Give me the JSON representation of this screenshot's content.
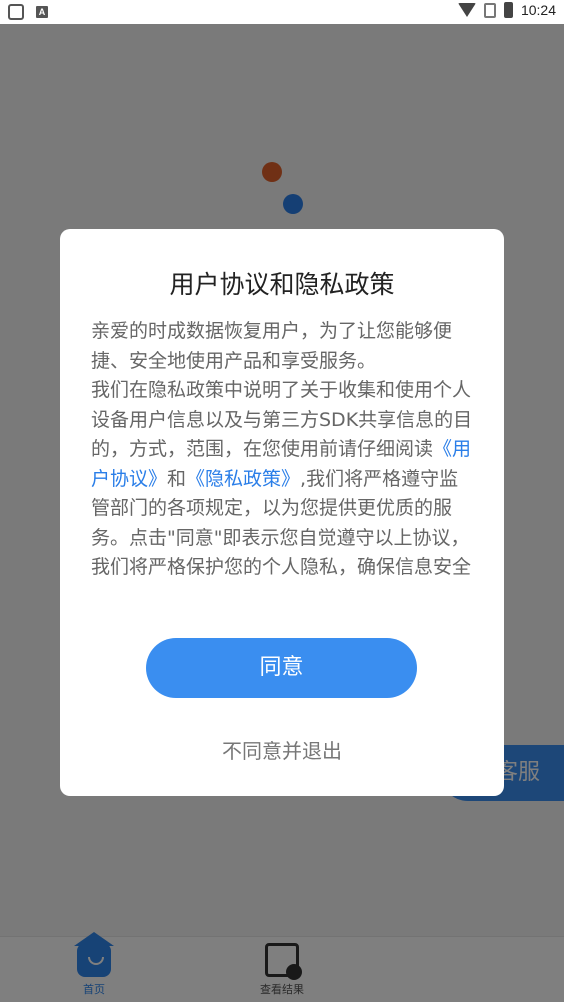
{
  "status_bar": {
    "time": "10:24",
    "left_icons": [
      "face-icon",
      "a-icon"
    ],
    "right_icons": [
      "wifi-icon",
      "sim-icon",
      "battery-icon"
    ]
  },
  "app": {
    "service_button_label": "客服",
    "bottom_nav": [
      {
        "label": "首页",
        "icon": "home-icon",
        "active": true
      },
      {
        "label": "查看结果",
        "icon": "results-icon",
        "active": false
      }
    ],
    "colors": {
      "accent": "#3a8ef0",
      "dot_orange": "#e0612b",
      "dot_blue": "#2a7ee8"
    }
  },
  "dialog": {
    "title": "用户协议和隐私政策",
    "paragraph1": "亲爱的时成数据恢复用户，为了让您能够便捷、安全地使用产品和享受服务。",
    "paragraph2_before": "我们在隐私政策中说明了关于收集和使用个人设备用户信息以及与第三方SDK共享信息的目的，方式，范围，在您使用前请仔细阅读",
    "user_agreement_link": "《用户协议》",
    "and_text": "和",
    "privacy_policy_link": "《隐私政策》",
    "paragraph2_after": ",我们将严格遵守监管部门的各项规定，以为您提供更优质的服务。点击\"同意\"即表示您自觉遵守以上协议，我们将严格保护您的个人隐私，确保信息安全",
    "agree_label": "同意",
    "disagree_label": "不同意并退出"
  }
}
